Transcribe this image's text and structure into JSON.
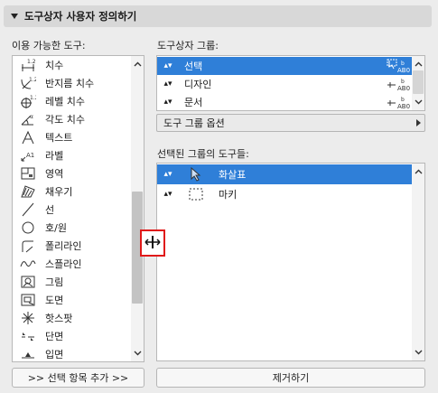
{
  "header": {
    "title": "도구상자 사용자 정의하기"
  },
  "available": {
    "label": "이용 가능한 도구:",
    "items": [
      {
        "label": "치수",
        "icon": "linear-dimension-icon"
      },
      {
        "label": "반지름 치수",
        "icon": "radial-dimension-icon"
      },
      {
        "label": "레벨 치수",
        "icon": "level-dimension-icon"
      },
      {
        "label": "각도 치수",
        "icon": "angle-dimension-icon"
      },
      {
        "label": "텍스트",
        "icon": "text-icon"
      },
      {
        "label": "라벨",
        "icon": "label-icon"
      },
      {
        "label": "영역",
        "icon": "zone-icon"
      },
      {
        "label": "채우기",
        "icon": "fill-icon"
      },
      {
        "label": "선",
        "icon": "line-icon"
      },
      {
        "label": "호/원",
        "icon": "arc-circle-icon"
      },
      {
        "label": "폴리라인",
        "icon": "polyline-icon"
      },
      {
        "label": "스플라인",
        "icon": "spline-icon"
      },
      {
        "label": "그림",
        "icon": "figure-icon"
      },
      {
        "label": "도면",
        "icon": "drawing-icon"
      },
      {
        "label": "핫스팟",
        "icon": "hotspot-icon"
      },
      {
        "label": "단면",
        "icon": "section-icon"
      },
      {
        "label": "입면",
        "icon": "elevation-icon"
      }
    ],
    "add_button": ">> 선택 항목 추가 >>"
  },
  "groups": {
    "label": "도구상자 그룹:",
    "items": [
      {
        "label": "선택",
        "selected": true
      },
      {
        "label": "디자인",
        "selected": false
      },
      {
        "label": "문서",
        "selected": false
      }
    ],
    "option_label": "도구 그룹 옵션"
  },
  "group_tools": {
    "label": "선택된 그룹의 도구들:",
    "items": [
      {
        "label": "화살표",
        "icon": "arrow-pointer-icon",
        "selected": true
      },
      {
        "label": "마키",
        "icon": "marquee-icon",
        "selected": false
      }
    ],
    "remove_button": "제거하기"
  },
  "colors": {
    "selection": "#2f7fd8",
    "highlight_border": "#e01919"
  }
}
